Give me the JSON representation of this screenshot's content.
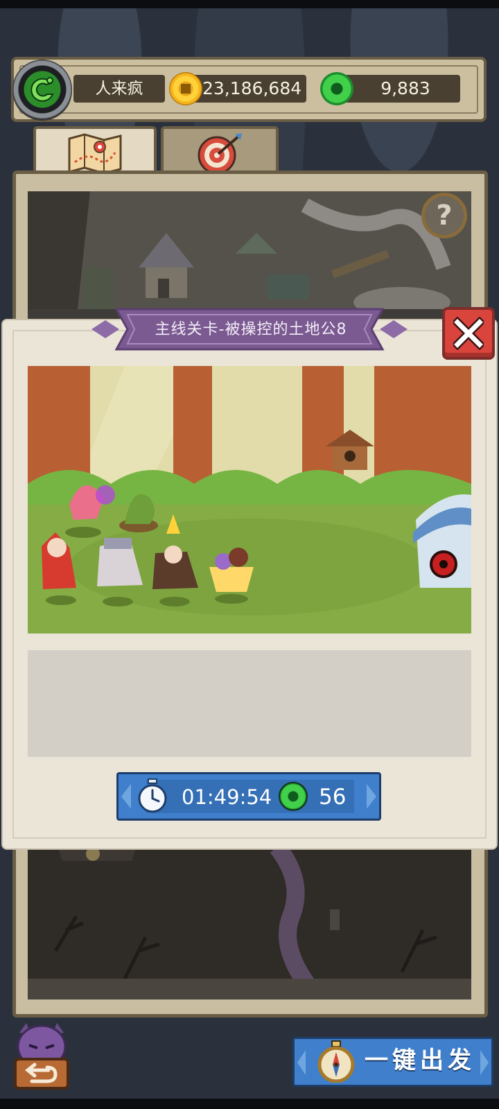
{
  "player": {
    "name": "人来疯"
  },
  "resources": {
    "gold": "23,186,684",
    "jade": "9,883"
  },
  "tabs": [
    {
      "icon": "map-icon",
      "active": true
    },
    {
      "icon": "target-icon",
      "active": false
    }
  ],
  "dialog": {
    "title": "主线关卡-被操控的土地公8",
    "timer": "01:49:54",
    "cost": "56"
  },
  "bottom": {
    "dispatch_label": "一键出发"
  },
  "colors": {
    "accent_blue": "#3f7fcc",
    "close_red": "#d9443d",
    "ribbon_purple": "#7b5a91",
    "frame_brown": "#6a5d45"
  }
}
